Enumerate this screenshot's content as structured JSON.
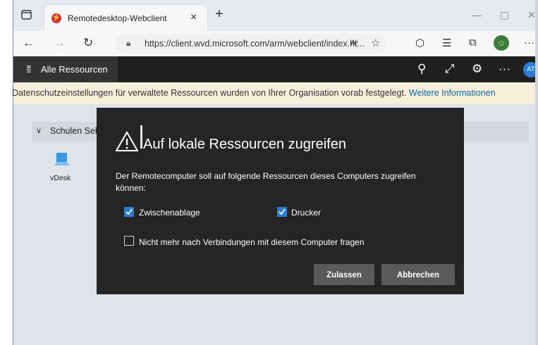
{
  "browser": {
    "tab_title": "Remotedesktop-Webclient",
    "tab_close": "×",
    "new_tab": "+",
    "favicon_letter": "⚡",
    "url": "https://client.wvd.microsoft.com/arm/webclient/index.ht...",
    "read_aloud": "A⁾",
    "window_min": "—",
    "window_max": "▢",
    "window_close": "✕",
    "more": "···"
  },
  "appbar": {
    "all_resources": "Alle Ressourcen",
    "user_initials": "AT",
    "more": "···"
  },
  "banner": {
    "text": "Datenschutzeinstellungen für verwaltete Ressourcen wurden von Ihrer Organisation vorab festgelegt. ",
    "link": "Weitere Informationen"
  },
  "resources": {
    "group_name": "Schulen Sek",
    "item_label": "vDesk"
  },
  "dialog": {
    "title": "Auf lokale Ressourcen zugreifen",
    "description": "Der Remotecomputer soll auf folgende Ressourcen dieses Computers zugreifen können:",
    "clipboard_label": "Zwischenablage",
    "clipboard_checked": true,
    "printer_label": "Drucker",
    "printer_checked": true,
    "dont_ask_label": "Nicht mehr nach Verbindungen mit diesem Computer fragen",
    "dont_ask_checked": false,
    "allow_button": "Zulassen",
    "cancel_button": "Abbrechen"
  },
  "colors": {
    "accent": "#2b7cd3",
    "dialog_bg": "#252526",
    "app_bar": "#1f1f1f",
    "banner_bg": "#f7efd9",
    "link": "#0b6aa8"
  },
  "icons": [
    "tab-actions-icon",
    "back-icon",
    "forward-icon",
    "refresh-icon",
    "lock-icon",
    "favorites-star-icon",
    "extensions-icon",
    "favorites-bar-icon",
    "collections-icon",
    "profile-icon",
    "apps-grid-icon",
    "pin-icon",
    "fullscreen-icon",
    "settings-gear-icon",
    "warning-icon",
    "monitor-icon"
  ]
}
